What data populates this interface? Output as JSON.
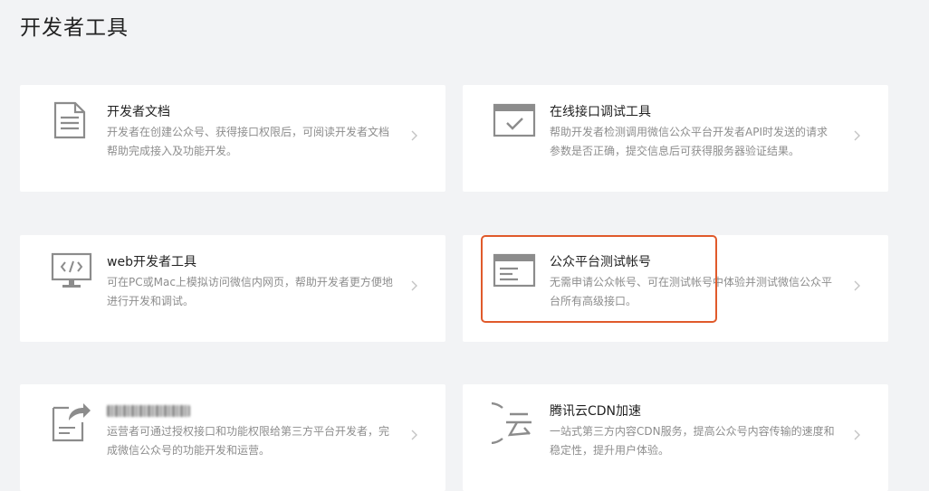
{
  "header": {
    "title": "开发者工具"
  },
  "cards": [
    {
      "id": "dev-docs",
      "title": "开发者文档",
      "description": "开发者在创建公众号、获得接口权限后，可阅读开发者文档帮助完成接入及功能开发。",
      "icon": "document-icon"
    },
    {
      "id": "api-debug",
      "title": "在线接口调试工具",
      "description": "帮助开发者检测调用微信公众平台开发者API时发送的请求参数是否正确，提交信息后可获得服务器验证结果。",
      "icon": "browser-check-icon"
    },
    {
      "id": "web-devtools",
      "title": "web开发者工具",
      "description": "可在PC或Mac上模拟访问微信内网页，帮助开发者更方便地进行开发和调试。",
      "icon": "monitor-code-icon"
    },
    {
      "id": "test-account",
      "title": "公众平台测试帐号",
      "description": "无需申请公众帐号、可在测试帐号中体验并测试微信公众平台所有高级接口。",
      "icon": "browser-window-icon",
      "highlighted": true,
      "highlight_color": "#e05a2b"
    },
    {
      "id": "third-party",
      "title": "",
      "title_obscured": true,
      "description": "运营者可通过授权接口和功能权限给第三方平台开发者，完成微信公众号的功能开发和运营。",
      "icon": "document-share-icon"
    },
    {
      "id": "cdn",
      "title": "腾讯云CDN加速",
      "description": "一站式第三方内容CDN服务，提高公众号内容传输的速度和稳定性，提升用户体验。",
      "icon": "cloud-yun-icon"
    }
  ],
  "colors": {
    "background": "#f2f3f5",
    "card": "#ffffff",
    "icon": "#8c8c8c",
    "highlight": "#e05a2b"
  }
}
